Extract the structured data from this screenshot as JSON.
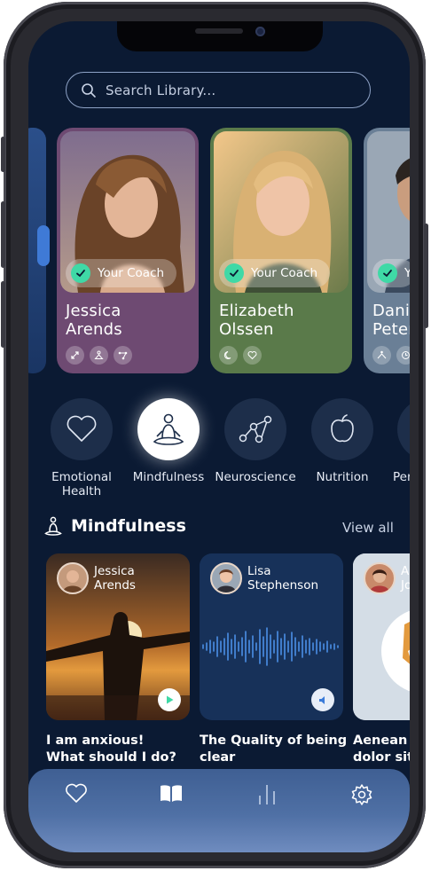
{
  "search": {
    "placeholder": "Search Library..."
  },
  "coaches": [
    {
      "first": "Jessica",
      "last": "Arends",
      "badge": "Your Coach",
      "color": "#6e4a72"
    },
    {
      "first": "Elizabeth",
      "last": "Olssen",
      "badge": "Your Coach",
      "color": "#5a7a4a"
    },
    {
      "first": "Dani",
      "last": "Peter",
      "badge": "Y",
      "color": "#6a7f96"
    }
  ],
  "categories": [
    {
      "label": "Emotional Health",
      "icon": "heart-icon"
    },
    {
      "label": "Mindfulness",
      "icon": "meditation-icon",
      "active": true
    },
    {
      "label": "Neuroscience",
      "icon": "network-icon"
    },
    {
      "label": "Nutrition",
      "icon": "apple-icon"
    },
    {
      "label": "Per",
      "icon": "circle-icon"
    }
  ],
  "section": {
    "title": "Mindfulness",
    "view_all": "View all"
  },
  "cards": [
    {
      "author": "Jessica Arends",
      "author_first": "Jessica",
      "author_last": "Arends",
      "title_line1": "I am anxious!",
      "title_line2": "What should I do?",
      "type": "video"
    },
    {
      "author_first": "Lisa",
      "author_last": "Stephenson",
      "title_line1": "The Quality of being",
      "title_line2": "clear",
      "type": "audio"
    },
    {
      "author_first": "As",
      "author_last": "Jo",
      "title_line1": "Aenean",
      "title_line2": "dolor sit",
      "type": "article"
    }
  ],
  "tabs": [
    {
      "name": "favorites",
      "icon": "heart-icon"
    },
    {
      "name": "library",
      "icon": "book-icon",
      "active": true
    },
    {
      "name": "stats",
      "icon": "bars-icon"
    },
    {
      "name": "settings",
      "icon": "gear-icon"
    }
  ],
  "colors": {
    "background": "#0b1a33",
    "accent": "#3fd9a6",
    "tabbar": "#4f70a5"
  }
}
